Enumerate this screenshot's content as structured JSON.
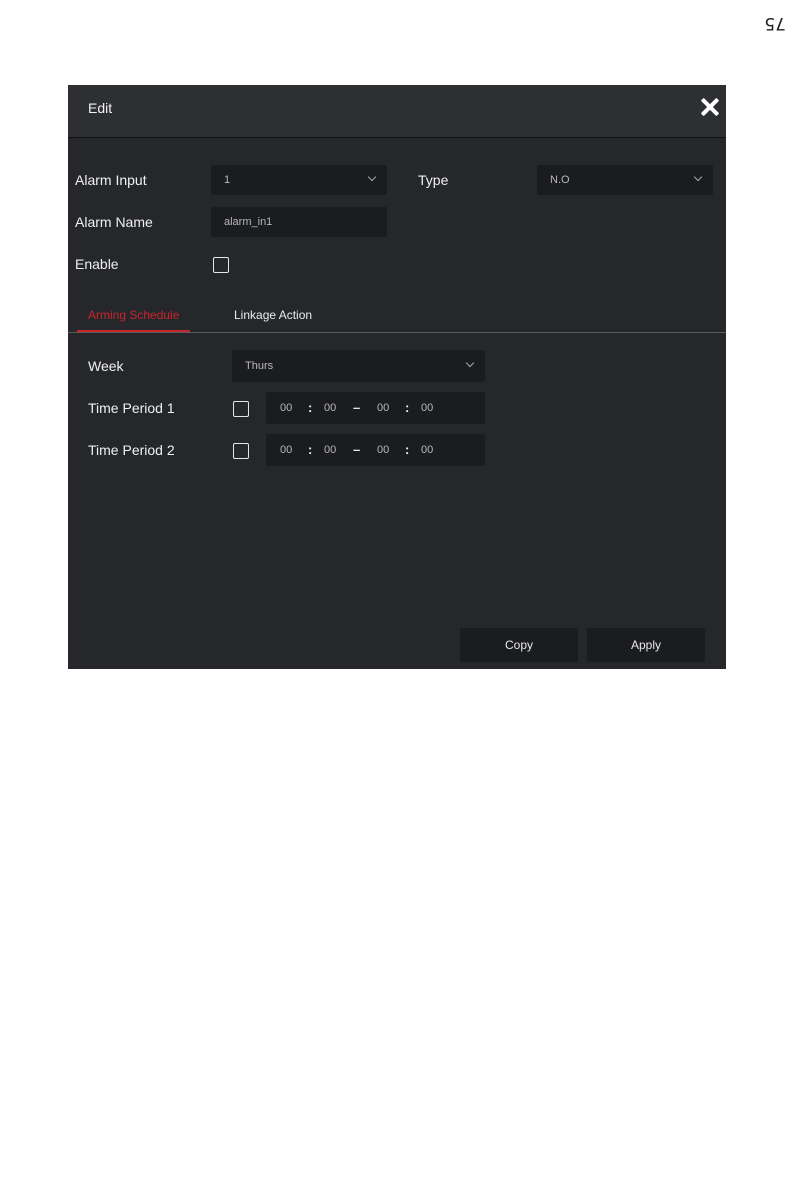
{
  "page_number": "75",
  "dialog": {
    "title": "Edit",
    "alarm_input": {
      "label": "Alarm Input",
      "value": "1"
    },
    "type": {
      "label": "Type",
      "value": "N.O"
    },
    "alarm_name": {
      "label": "Alarm Name",
      "value": "alarm_in1"
    },
    "enable": {
      "label": "Enable",
      "checked": false
    },
    "tabs": [
      {
        "label": "Arming Schedule",
        "active": true
      },
      {
        "label": "Linkage Action",
        "active": false
      }
    ],
    "week": {
      "label": "Week",
      "value": "Thurs"
    },
    "time_periods": [
      {
        "label": "Time Period 1",
        "checked": false,
        "start_h": "00",
        "start_m": "00",
        "end_h": "00",
        "end_m": "00"
      },
      {
        "label": "Time Period 2",
        "checked": false,
        "start_h": "00",
        "start_m": "00",
        "end_h": "00",
        "end_m": "00"
      }
    ],
    "buttons": {
      "copy": "Copy",
      "apply": "Apply"
    },
    "colors": {
      "accent": "#c8262b",
      "background": "#25272b",
      "field": "#1b1c1f"
    }
  }
}
